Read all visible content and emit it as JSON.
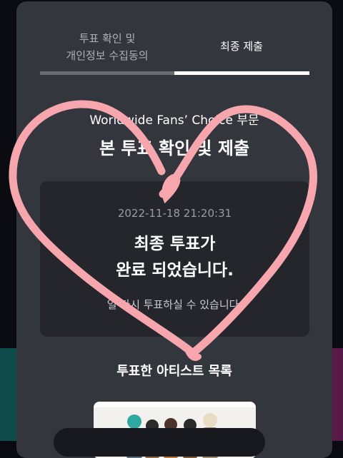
{
  "tabs": {
    "tab1_line1": "투표 확인 및",
    "tab1_line2": "개인정보 수집동의",
    "tab2": "최종 제출"
  },
  "main": {
    "event_title": "Worldwide Fans’ Choice 부문",
    "heading": "본 투표 확인 및 제출"
  },
  "result_card": {
    "timestamp": "2022-11-18 21:20:31",
    "line1": "최종 투표가",
    "line2": "완료 되었습니다.",
    "note": "일 다시 투표하실 수 있습니다."
  },
  "artists": {
    "title": "투표한 아티스트 목록"
  },
  "colors": {
    "modal_bg": "#34363d",
    "card_bg": "#24262c",
    "heart": "#f7a6ad"
  }
}
